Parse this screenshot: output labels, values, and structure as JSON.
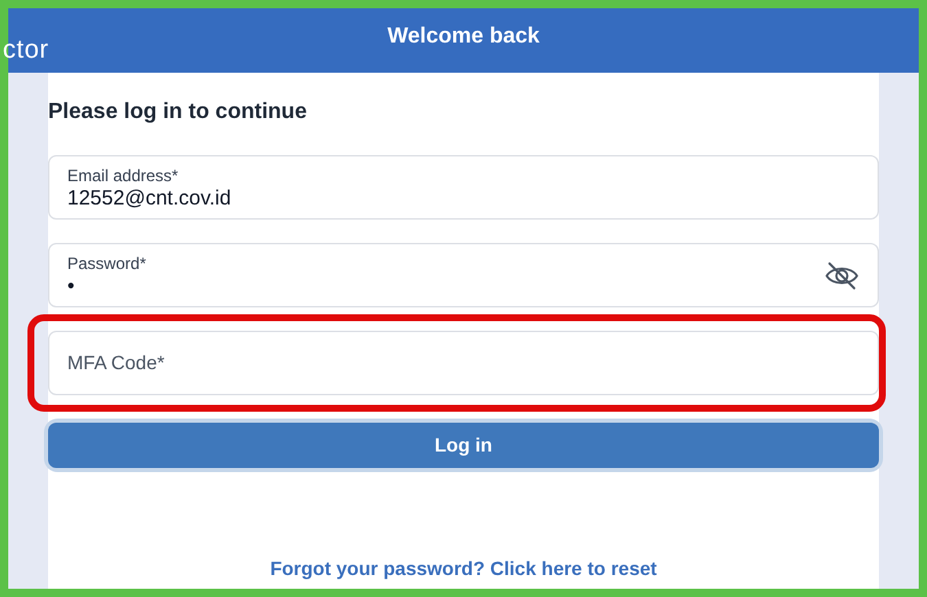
{
  "header": {
    "logo": "ctor",
    "title": "Welcome back"
  },
  "form": {
    "heading": "Please log in to continue",
    "fields": [
      {
        "kind": "text",
        "label": "Email address*",
        "value": "12552@cnt.cov.id",
        "highlighted": false
      },
      {
        "kind": "password",
        "label": "Password*",
        "value": "•",
        "highlighted": false
      },
      {
        "kind": "empty",
        "placeholder": "MFA Code*",
        "highlighted": true
      }
    ],
    "submit": "Log in",
    "forgot_link": "Forgot your password? Click here to reset"
  }
}
